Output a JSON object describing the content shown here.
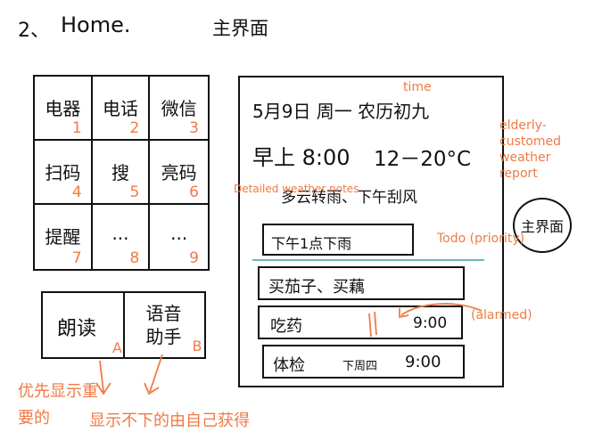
{
  "header": {
    "number": "2、",
    "title": "Home.",
    "title_cn": "主界面"
  },
  "app_grid": [
    {
      "label": "电器",
      "num": "1"
    },
    {
      "label": "电话",
      "num": "2"
    },
    {
      "label": "微信",
      "num": "3"
    },
    {
      "label": "扫码",
      "num": "4"
    },
    {
      "label": "搜",
      "num": "5"
    },
    {
      "label": "亮码",
      "num": "6"
    },
    {
      "label": "提醒",
      "num": "7"
    },
    {
      "label": "...",
      "num": "8"
    },
    {
      "label": "...",
      "num": "9"
    }
  ],
  "lower_buttons": [
    {
      "label": "朗读",
      "letter": "A"
    },
    {
      "label": "语音助手",
      "letter": "B"
    }
  ],
  "phone": {
    "date": "5月9日 周一 农历初九",
    "time": "早上 8:00",
    "temp": "12－20°C",
    "weather": "多云转雨、下午刮风",
    "weather_note": "下午1点下雨",
    "todos": [
      {
        "text": "买茄子、买藕",
        "time": ""
      },
      {
        "text": "吃药",
        "time": "9:00"
      },
      {
        "text": "体检",
        "day": "下周四",
        "time": "9:00"
      }
    ]
  },
  "home_circle": "主界面",
  "annotations": {
    "time": "time",
    "elderly": "elderly-customed weather report",
    "detailed": "Detailed weather notes",
    "todo": "Todo (priority)",
    "alarmed": "(alarmed)",
    "bottom_left": "优先显示重要的",
    "bottom_right": "显示不下的由自己获得"
  },
  "colors": {
    "ink": "#111111",
    "annotation": "#f07a45",
    "divider": "#3a9d9d"
  }
}
